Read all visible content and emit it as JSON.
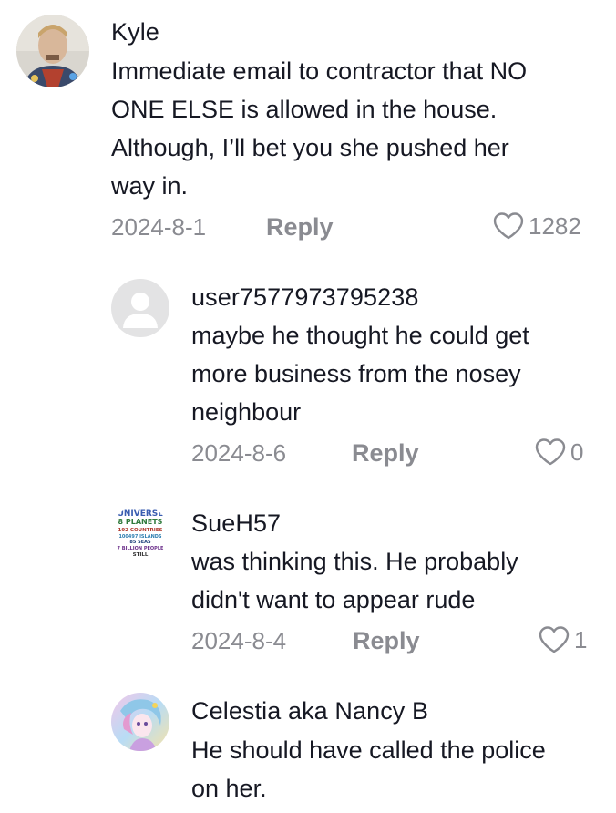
{
  "comments": [
    {
      "username": "Kyle",
      "lines": [
        "Immediate email to contractor that NO",
        "ONE ELSE is allowed in the house.",
        "Although, I’ll bet you she pushed her",
        "way in."
      ],
      "date": "2024-8-1",
      "reply_label": "Reply",
      "likes": "1282",
      "avatar_icon": "user-photo-avatar"
    },
    {
      "username": "user7577973795238",
      "lines": [
        "maybe he thought he could get",
        "more business from the nosey",
        "neighbour"
      ],
      "date": "2024-8-6",
      "reply_label": "Reply",
      "likes": "0",
      "avatar_icon": "default-avatar"
    },
    {
      "username": "SueH57",
      "lines": [
        "was thinking this. He probably",
        "didn't want to appear rude"
      ],
      "date": "2024-8-4",
      "reply_label": "Reply",
      "likes": "1",
      "avatar_icon": "text-graphic-avatar"
    },
    {
      "username": "Celestia aka Nancy B",
      "lines": [
        "He should have called the police",
        "on her."
      ],
      "avatar_icon": "illustration-avatar"
    }
  ],
  "avatar_graphic_text": [
    "UNIVERSE",
    "8 PLANETS",
    "192 COUNTRIES",
    "100497 ISLANDS",
    "85 SEAS",
    "7 BILLION PEOPLE",
    "STILL"
  ],
  "colors": {
    "text": "#161823",
    "meta": "#8a8b91",
    "background": "#ffffff"
  }
}
